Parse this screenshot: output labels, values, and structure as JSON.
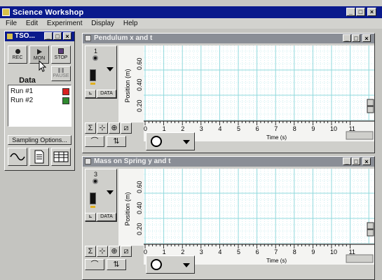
{
  "app": {
    "title": "Science Workshop",
    "menu": [
      "File",
      "Edit",
      "Experiment",
      "Display",
      "Help"
    ]
  },
  "control_panel": {
    "title": "TSO...",
    "buttons": {
      "rec": "REC",
      "mon": "MON",
      "stop": "STOP",
      "pause": "PAUSE"
    },
    "data_label": "Data",
    "runs": [
      {
        "label": "Run #1",
        "color": "#d92020"
      },
      {
        "label": "Run #2",
        "color": "#2f8a2f"
      }
    ],
    "sampling_button": "Sampling Options..."
  },
  "graphs": [
    {
      "title": "Pendulum x and t",
      "channel": "1",
      "data_button": "DATA",
      "y_label": "Position (m)",
      "y_ticks": [
        "0.20",
        "0.40",
        "0.60"
      ],
      "x_label": "Time (s)",
      "x_ticks": [
        "0",
        "1",
        "2",
        "3",
        "4",
        "5",
        "6",
        "7",
        "8",
        "9",
        "10",
        "11"
      ]
    },
    {
      "title": "Mass on Spring y and t",
      "channel": "3",
      "data_button": "DATA",
      "y_label": "Position (m)",
      "y_ticks": [
        "0.20",
        "0.40",
        "0.60"
      ],
      "x_label": "Time (s)",
      "x_ticks": [
        "0",
        "1",
        "2",
        "3",
        "4",
        "5",
        "6",
        "7",
        "8",
        "9",
        "10",
        "11"
      ]
    }
  ],
  "colors": {
    "title_bar": "#0a1a8c",
    "inner_title_bar": "#8a8e96",
    "grid": "#8fd8dc"
  }
}
